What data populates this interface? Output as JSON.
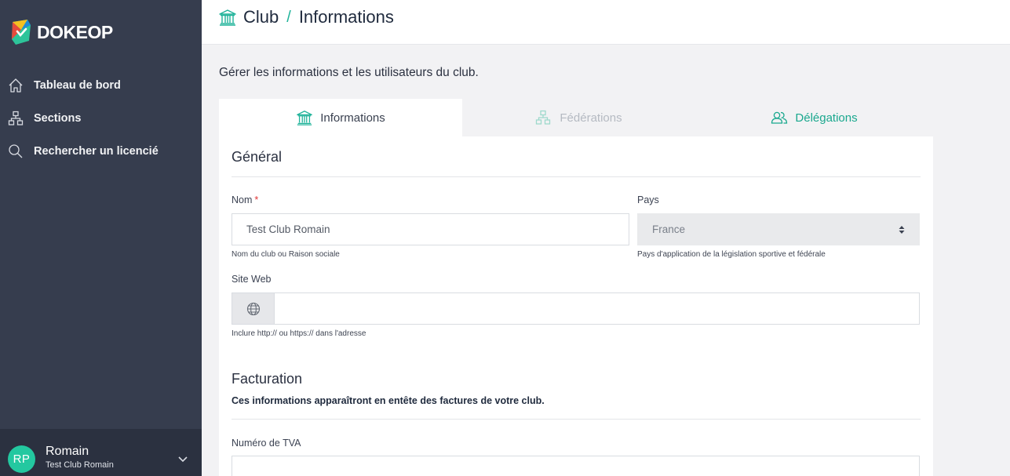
{
  "app": {
    "name": "DOKEOP"
  },
  "sidebar": {
    "items": [
      {
        "label": "Tableau de bord",
        "icon": "home-icon"
      },
      {
        "label": "Sections",
        "icon": "sitemap-icon"
      },
      {
        "label": "Rechercher un licencié",
        "icon": "search-icon"
      }
    ]
  },
  "user": {
    "initials": "RP",
    "name": "Romain",
    "club": "Test Club Romain"
  },
  "header": {
    "crumb_root": "Club",
    "separator": "/",
    "crumb_current": "Informations"
  },
  "main": {
    "intro": "Gérer les informations et les utilisateurs du club.",
    "tabs": [
      {
        "label": "Informations",
        "state": "active"
      },
      {
        "label": "Fédérations",
        "state": "disabled"
      },
      {
        "label": "Délégations",
        "state": "link"
      }
    ]
  },
  "form": {
    "general_title": "Général",
    "nom_label": "Nom",
    "nom_required_mark": "*",
    "nom_value": "Test Club Romain",
    "nom_help": "Nom du club ou Raison sociale",
    "pays_label": "Pays",
    "pays_value": "France",
    "pays_help": "Pays d'application de la législation sportive et fédérale",
    "site_label": "Site Web",
    "site_value": "",
    "site_help": "Inclure http:// ou https:// dans l'adresse",
    "billing_title": "Facturation",
    "billing_subtitle": "Ces informations apparaîtront en entête des factures de votre club.",
    "tva_label": "Numéro de TVA",
    "tva_value": ""
  },
  "colors": {
    "sidebar_bg": "#363d4e",
    "accent": "#20b39a",
    "avatar_bg": "#23c8a0",
    "required": "#e03434"
  }
}
